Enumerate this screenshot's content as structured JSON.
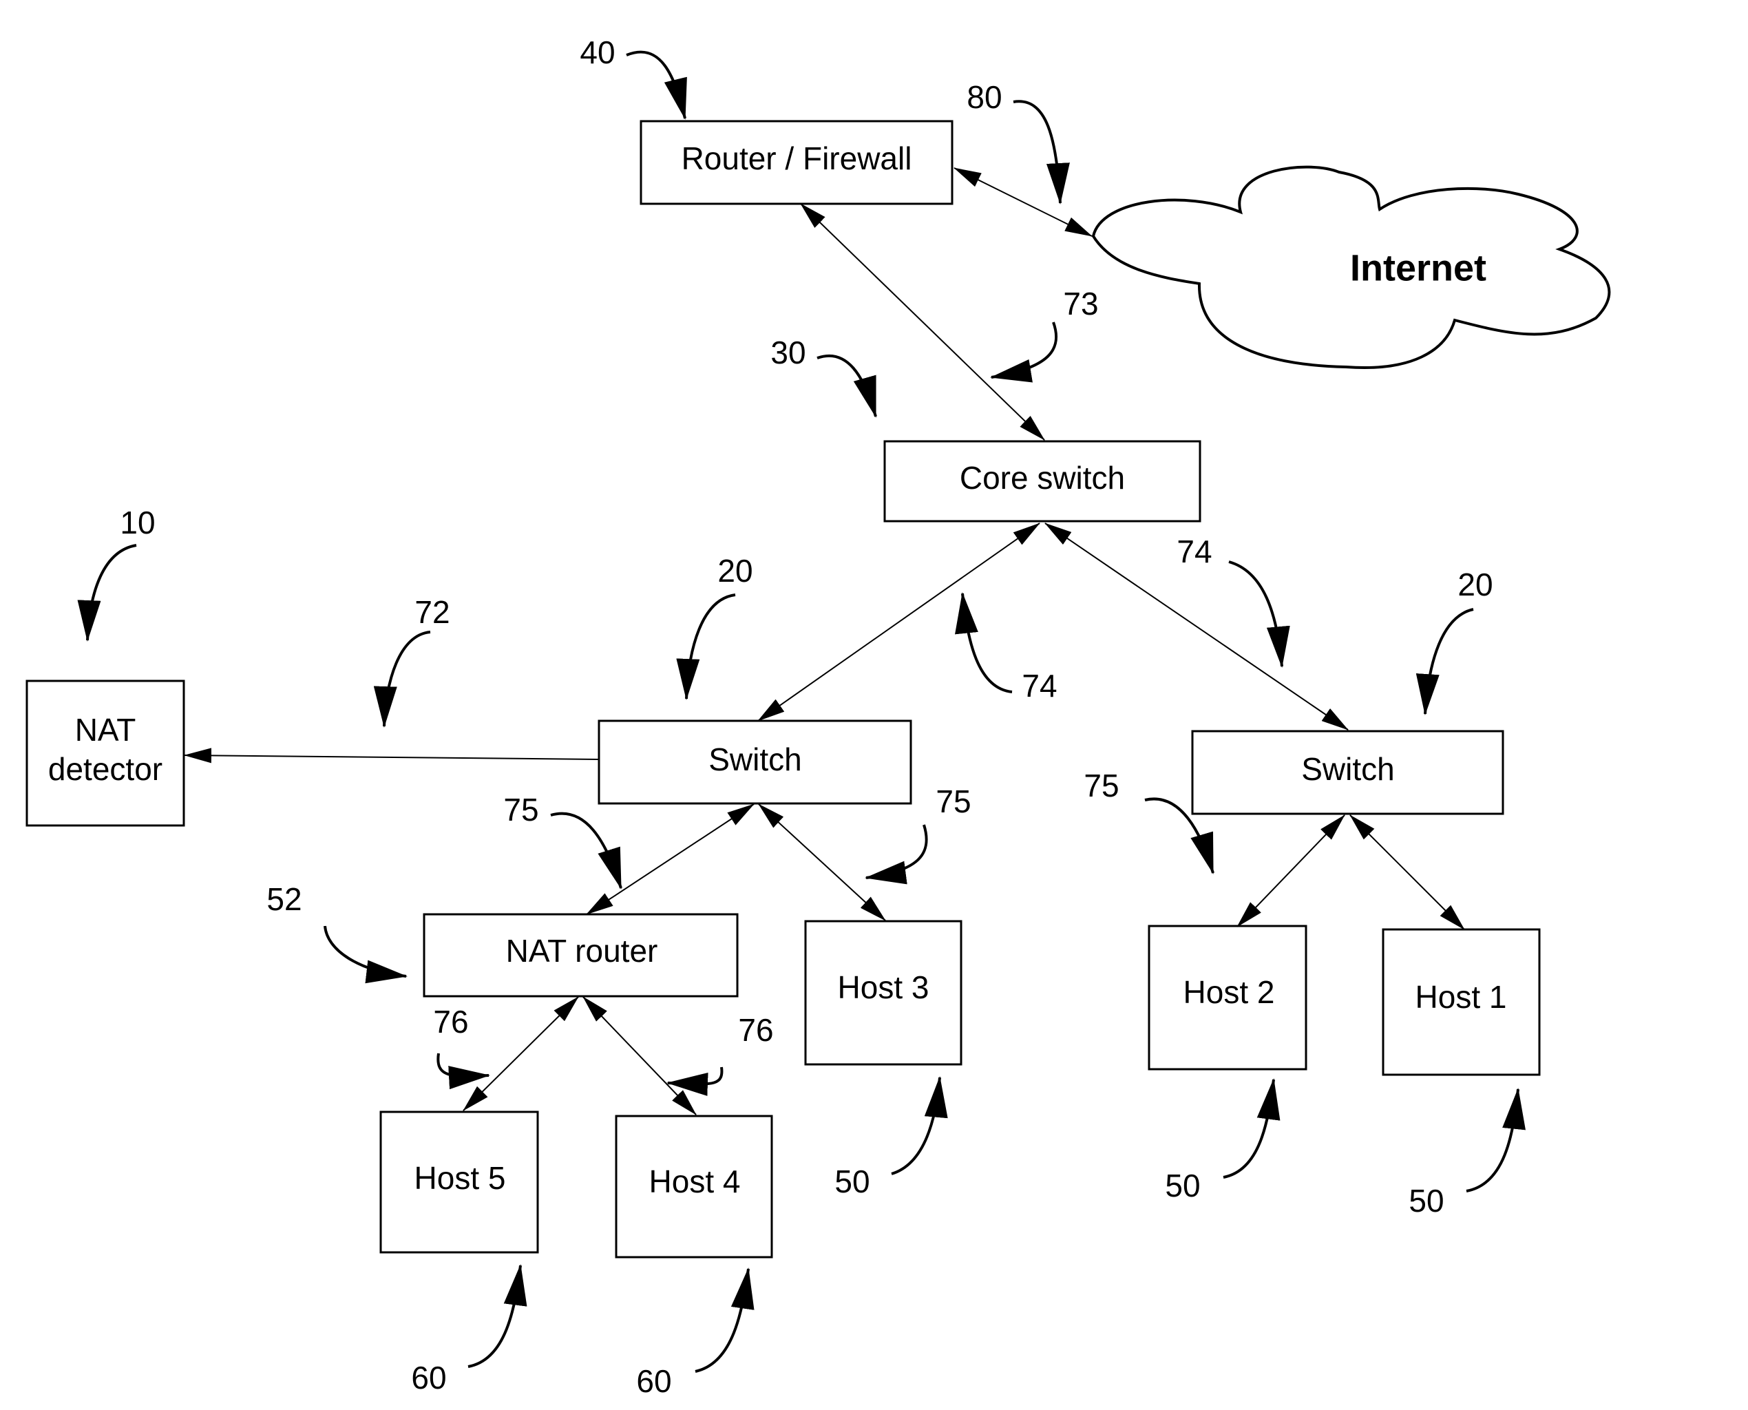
{
  "figure": {
    "type": "network-topology-diagram",
    "nodes": {
      "router_firewall": {
        "label": "Router / Firewall",
        "ref": "40"
      },
      "internet": {
        "label": "Internet",
        "ref": "80"
      },
      "core_switch": {
        "label": "Core switch",
        "ref": "30"
      },
      "nat_detector": {
        "label_line1": "NAT",
        "label_line2": "detector",
        "ref": "10"
      },
      "switch_left": {
        "label": "Switch",
        "ref": "20"
      },
      "switch_right": {
        "label": "Switch",
        "ref": "20"
      },
      "nat_router": {
        "label": "NAT router",
        "ref": "52"
      },
      "host3": {
        "label": "Host 3",
        "ref": "50"
      },
      "host2": {
        "label": "Host 2",
        "ref": "50"
      },
      "host1": {
        "label": "Host 1",
        "ref": "50"
      },
      "host5": {
        "label": "Host 5",
        "ref": "60"
      },
      "host4": {
        "label": "Host 4",
        "ref": "60"
      }
    },
    "link_refs": {
      "router_core": "73",
      "core_switch_left": "74",
      "core_switch_right": "74",
      "switch_left_nat_detector": "72",
      "switch_left_nat_router": "75",
      "switch_left_host3": "75",
      "switch_right_hosts": "75",
      "nat_router_host5": "76",
      "nat_router_host4": "76"
    },
    "connections": [
      {
        "from": "Router / Firewall",
        "to": "Internet",
        "direction": "bidirectional"
      },
      {
        "from": "Router / Firewall",
        "to": "Core switch",
        "direction": "bidirectional"
      },
      {
        "from": "Core switch",
        "to": "Switch (left)",
        "direction": "bidirectional"
      },
      {
        "from": "Core switch",
        "to": "Switch (right)",
        "direction": "bidirectional"
      },
      {
        "from": "Switch (left)",
        "to": "NAT detector",
        "direction": "one-way"
      },
      {
        "from": "Switch (left)",
        "to": "NAT router",
        "direction": "bidirectional"
      },
      {
        "from": "Switch (left)",
        "to": "Host 3",
        "direction": "bidirectional"
      },
      {
        "from": "Switch (right)",
        "to": "Host 2",
        "direction": "bidirectional"
      },
      {
        "from": "Switch (right)",
        "to": "Host 1",
        "direction": "bidirectional"
      },
      {
        "from": "NAT router",
        "to": "Host 5",
        "direction": "bidirectional"
      },
      {
        "from": "NAT router",
        "to": "Host 4",
        "direction": "bidirectional"
      }
    ]
  }
}
